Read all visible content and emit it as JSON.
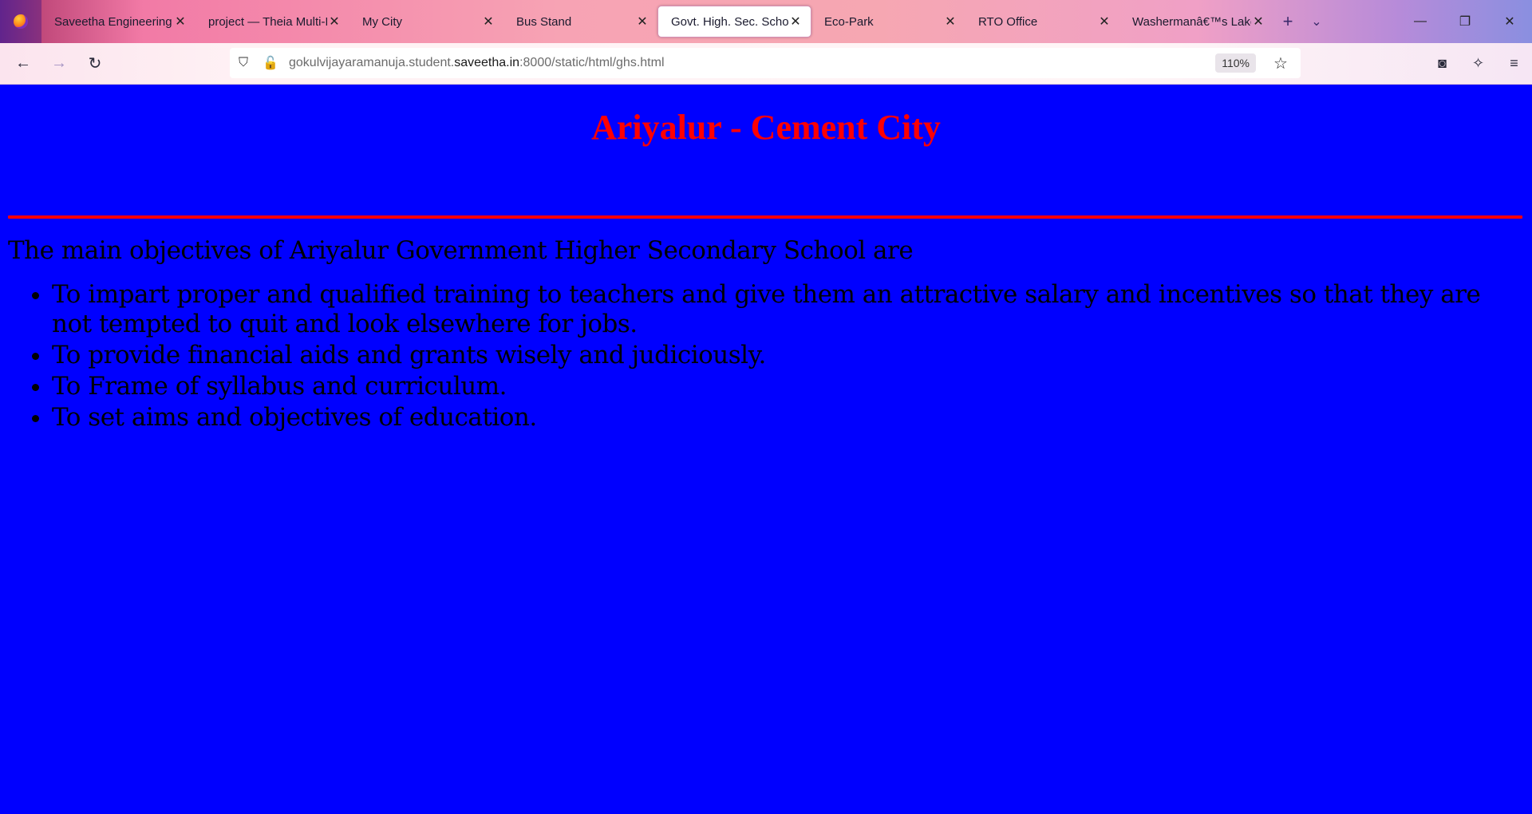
{
  "browser": {
    "tabs": [
      {
        "title": "Saveetha Engineering College",
        "active": false
      },
      {
        "title": "project — Theia Multi-Language",
        "active": false
      },
      {
        "title": "My City",
        "active": false
      },
      {
        "title": "Bus Stand",
        "active": false
      },
      {
        "title": "Govt. High. Sec. School",
        "active": true
      },
      {
        "title": "Eco-Park",
        "active": false
      },
      {
        "title": "RTO Office",
        "active": false
      },
      {
        "title": "Washermanâ€™s Lake",
        "active": false
      }
    ],
    "url": {
      "prefix": "gokulvijayaramanuja.student.",
      "domain": "saveetha.in",
      "suffix": ":8000/static/html/ghs.html"
    },
    "zoom": "110%"
  },
  "page": {
    "title": "Ariyalur - Cement City",
    "intro": "The main objectives of Ariyalur Government Higher Secondary School are",
    "objectives": [
      "To impart proper and qualified training to teachers and give them an attractive salary and incentives so that they are not tempted to quit and look elsewhere for jobs.",
      "To provide financial aids and grants wisely and judiciously.",
      "To Frame of syllabus and curriculum.",
      "To set aims and objectives of education."
    ],
    "background_color": "#0000ff",
    "title_color": "#ff0000"
  },
  "icons": {
    "back": "back-arrow-icon",
    "forward": "forward-arrow-icon",
    "reload": "reload-icon",
    "shield": "tracking-protection-icon",
    "insecure": "insecure-lock-icon",
    "bookmark": "star-icon",
    "pocket": "pocket-icon",
    "extensions": "extensions-icon",
    "menu": "hamburger-menu-icon"
  }
}
